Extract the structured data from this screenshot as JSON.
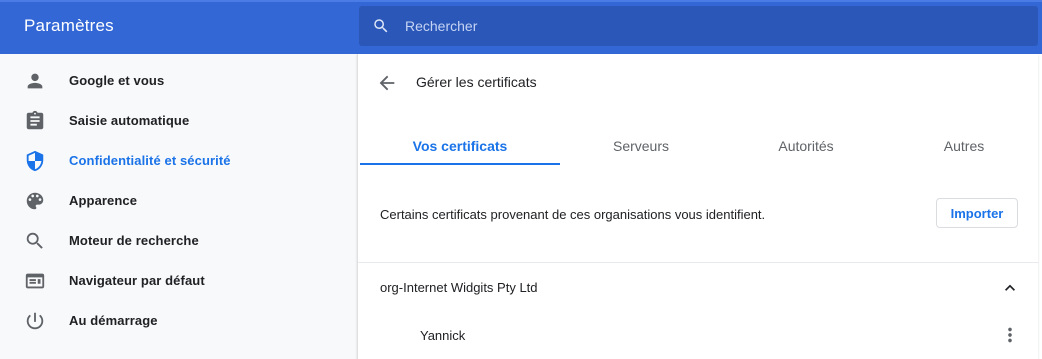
{
  "header": {
    "title": "Paramètres",
    "search_placeholder": "Rechercher"
  },
  "sidebar": {
    "items": [
      {
        "label": "Google et vous",
        "icon": "person-icon",
        "active": false
      },
      {
        "label": "Saisie automatique",
        "icon": "clipboard-icon",
        "active": false
      },
      {
        "label": "Confidentialité et sécurité",
        "icon": "shield-icon",
        "active": true
      },
      {
        "label": "Apparence",
        "icon": "palette-icon",
        "active": false
      },
      {
        "label": "Moteur de recherche",
        "icon": "search-icon",
        "active": false
      },
      {
        "label": "Navigateur par défaut",
        "icon": "browser-window-icon",
        "active": false
      },
      {
        "label": "Au démarrage",
        "icon": "power-icon",
        "active": false
      }
    ]
  },
  "main": {
    "title": "Gérer les certificats",
    "tabs": [
      {
        "label": "Vos certificats",
        "active": true
      },
      {
        "label": "Serveurs",
        "active": false
      },
      {
        "label": "Autorités",
        "active": false
      },
      {
        "label": "Autres",
        "active": false
      }
    ],
    "description": "Certains certificats provenant de ces organisations vous identifient.",
    "import_label": "Importer",
    "organization": "org-Internet Widgits Pty Ltd",
    "certificate": "Yannick"
  },
  "colors": {
    "header_bg": "#3367d6",
    "search_bg": "#2a57b8",
    "accent": "#1a73e8",
    "sidebar_bg": "#f8f9fa",
    "text": "#202124",
    "icon": "#5f6368"
  }
}
